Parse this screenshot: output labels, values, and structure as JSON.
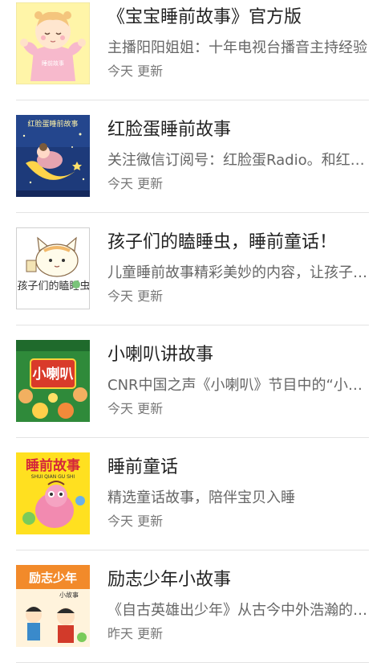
{
  "stories": [
    {
      "title": "《宝宝睡前故事》官方版",
      "description": "主播阳阳姐姐：十年电视台播音主持经验",
      "updated": "今天 更新",
      "cover_text": "睡前故事"
    },
    {
      "title": "红脸蛋睡前故事",
      "description": "关注微信订阅号：红脸蛋Radio。和红脸蛋一起",
      "updated": "今天 更新",
      "cover_text": "红脸蛋睡前故事"
    },
    {
      "title": "孩子们的瞌睡虫，睡前童话！",
      "description": "儿童睡前故事精彩美妙的内容，让孩子们安然入睡",
      "updated": "今天 更新",
      "cover_text": "孩子们的瞌睡虫"
    },
    {
      "title": "小喇叭讲故事",
      "description": "CNR中国之声《小喇叭》节目中的“小喇叭开始广播啦”",
      "updated": "今天 更新",
      "cover_text": "小喇叭"
    },
    {
      "title": "睡前童话",
      "description": "精选童话故事，陪伴宝贝入睡",
      "updated": "今天 更新",
      "cover_text": "睡前故事",
      "cover_subtext": "SHUI QIAN GU SHI"
    },
    {
      "title": "励志少年小故事",
      "description": "《自古英雄出少年》从古今中外浩瀚的历史中",
      "updated": "昨天 更新",
      "cover_text": "励志少年",
      "cover_subtext": "小故事"
    }
  ]
}
